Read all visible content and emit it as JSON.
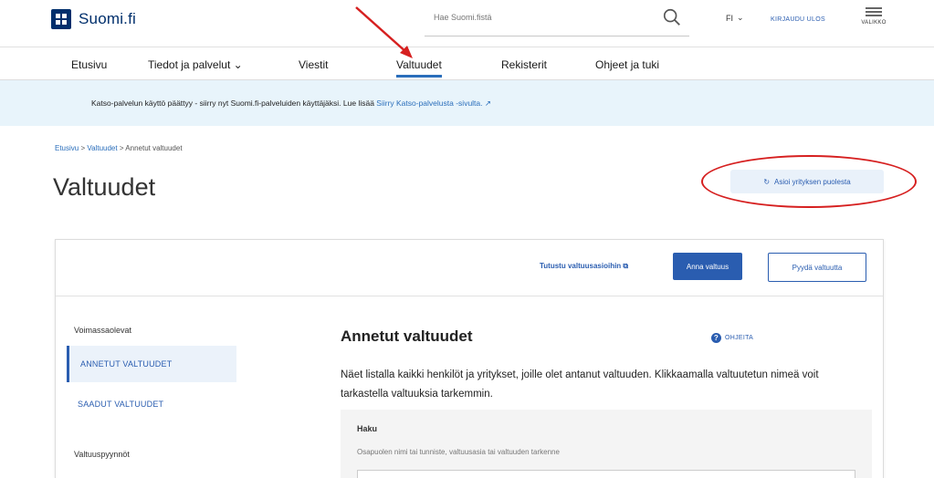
{
  "header": {
    "brand": "Suomi.fi",
    "search_placeholder": "Hae Suomi.fistä",
    "lang": "FI",
    "lang_chevron": "⌄",
    "login_label": "KIRJAUDU ULOS",
    "menu_label": "VALIKKO"
  },
  "nav": {
    "items": [
      "Etusivu",
      "Tiedot ja palvelut ⌄",
      "Viestit",
      "Valtuudet",
      "Rekisterit",
      "Ohjeet ja tuki"
    ]
  },
  "notice": {
    "text": "Katso-palvelun käyttö päättyy - siirry nyt Suomi.fi-palveluiden käyttäjäksi. Lue lisää ",
    "link": "Siirry Katso-palvelusta -sivulta.",
    "link_icon": "↗"
  },
  "breadcrumb": {
    "items": [
      "Etusivu",
      "Valtuudet",
      "Annetut valtuudet"
    ],
    "separator": ">"
  },
  "page": {
    "title": "Valtuudet",
    "act_button": "Asioi yrityksen puolesta",
    "act_icon": "↻"
  },
  "panel": {
    "learn_link": "Tutustu valtuusasioihin ⧉",
    "give_button": "Anna valtuus",
    "request_button": "Pyydä valtuutta",
    "side": {
      "heading1": "Voimassaolevat",
      "item_given": "ANNETUT VALTUUDET",
      "item_received": "SAADUT VALTUUDET",
      "heading2": "Valtuuspyynnöt"
    },
    "content_title": "Annetut valtuudet",
    "help_label": "OHJEITA",
    "help_icon": "?",
    "description": "Näet listalla kaikki henkilöt ja yritykset, joille olet antanut valtuuden. Klikkaamalla valtuutetun nimeä voit tarkastella valtuuksia tarkemmin.",
    "search_label": "Haku",
    "search_hint": "Osapuolen nimi tai tunniste, valtuusasia tai valtuuden tarkenne"
  }
}
